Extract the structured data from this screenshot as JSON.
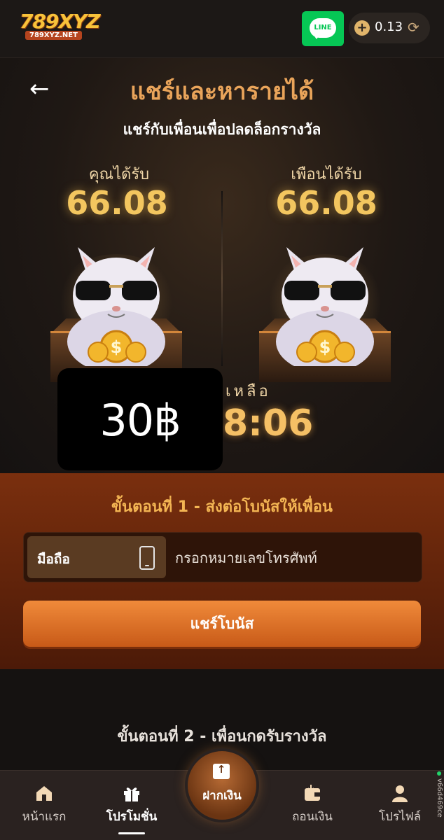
{
  "header": {
    "logo_text": "789XYZ",
    "logo_subtext": "789XYZ.NET",
    "line_label": "LINE",
    "balance": "0.13",
    "accent_color": "#f7c23a"
  },
  "hero": {
    "title": "แชร์และหารายได้",
    "subtitle": "แชร์กับเพื่อนเพื่อปลดล็อกรางวัล",
    "you_receive_label": "คุณได้รับ",
    "you_receive_value": "66.08",
    "friend_receive_label": "เพือนได้รับ",
    "friend_receive_value": "66.08",
    "timer_label": "เหลือ",
    "timer_value": "8:06",
    "badge_text": "30฿"
  },
  "step1": {
    "title": "ขั้นตอนที่ 1 - ส่งต่อโบนัสให้เพื่อน",
    "phone_tag_label": "มือถือ",
    "phone_placeholder": "กรอกหมายเลขโทรศัพท์",
    "share_button_label": "แชร์โบนัส",
    "panel_color": "#7a2f0e"
  },
  "step2": {
    "title": "ขั้นตอนที่ 2 - เพื่อนกดรับรางวัล"
  },
  "bottom_nav": {
    "items": [
      {
        "label": "หน้าแรก",
        "icon": "home-icon"
      },
      {
        "label": "โปรโมชั่น",
        "icon": "gift-icon",
        "active": true
      },
      {
        "label": "ฝากเงิน",
        "icon": "deposit-icon"
      },
      {
        "label": "ถอนเงิน",
        "icon": "withdraw-icon"
      },
      {
        "label": "โปรไฟล์",
        "icon": "profile-icon"
      }
    ],
    "version": "v66d469ce"
  }
}
